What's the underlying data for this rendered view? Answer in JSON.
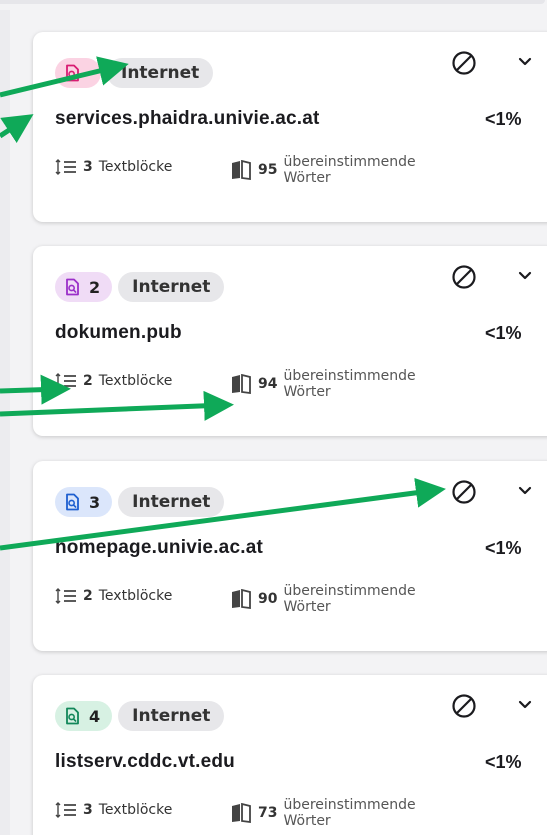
{
  "colors": {
    "arrow": "#0fa958",
    "card_bg": "#ffffff",
    "pill_bg": "#e7e7ea"
  },
  "labels": {
    "textblocks": "Textblöcke",
    "matching_words_line1": "übereinstimmende",
    "matching_words_line2": "Wörter"
  },
  "sources": [
    {
      "rank": "",
      "type": "Internet",
      "title": "services.phaidra.univie.ac.at",
      "percent": "<1%",
      "textblocks": "3",
      "words": "95",
      "badge_color": "#fbd3e3",
      "icon_color": "#d81b72"
    },
    {
      "rank": "2",
      "type": "Internet",
      "title": "dokumen.pub",
      "percent": "<1%",
      "textblocks": "2",
      "words": "94",
      "badge_color": "#f0dcf6",
      "icon_color": "#9b2fc9"
    },
    {
      "rank": "3",
      "type": "Internet",
      "title": "homepage.univie.ac.at",
      "percent": "<1%",
      "textblocks": "2",
      "words": "90",
      "badge_color": "#dbe6fb",
      "icon_color": "#1e5fd0"
    },
    {
      "rank": "4",
      "type": "Internet",
      "title": "listserv.cddc.vt.edu",
      "percent": "<1%",
      "textblocks": "3",
      "words": "73",
      "badge_color": "#d7f1e3",
      "icon_color": "#12875a"
    }
  ]
}
